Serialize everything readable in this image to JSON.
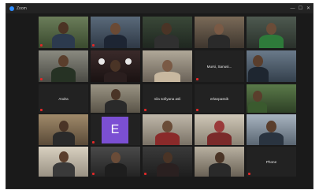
{
  "window": {
    "title": "Zoom"
  },
  "controls": {
    "minimize": "—",
    "maximize": "☐",
    "close": "✕"
  },
  "name_tiles": {
    "r1c5": "Mursi, Sanusi...",
    "r2c1": "Andra",
    "r2c3": "nila sofiyana asli",
    "r2c4": "erlanpassik",
    "r4c6": "Phone"
  },
  "avatar": {
    "letter": "E",
    "color": "#7b4fd3"
  },
  "colors": {
    "active_speaker_outline": "#d2e12d",
    "muted_mic": "#e02828",
    "tile_background": "#222222",
    "window_background": "#1a1a1a"
  },
  "icons": {
    "app": "zoom-icon",
    "muted": "muted-mic-icon"
  }
}
